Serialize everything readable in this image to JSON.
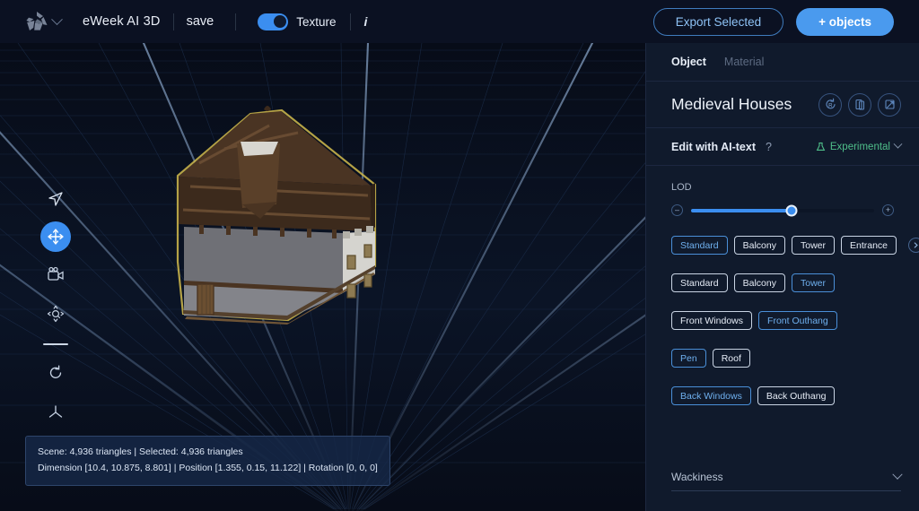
{
  "topbar": {
    "logo_icon": "recycle-logo-icon",
    "logo_chevron_icon": "chevron-down-icon",
    "brand": "eWeek AI 3D",
    "save_label": "save",
    "texture_label": "Texture",
    "texture_on": true,
    "info_label": "i",
    "export_label": "Export Selected",
    "add_objects_label": "+ objects",
    "accent": "#4a9aee"
  },
  "toolbar": {
    "items": [
      {
        "name": "select-cursor-icon",
        "active": false
      },
      {
        "name": "move-tool-icon",
        "active": true
      },
      {
        "name": "camera-tool-icon",
        "active": false
      },
      {
        "name": "scale-tool-icon",
        "active": false
      },
      {
        "name": "divider",
        "active": false
      },
      {
        "name": "rotate-tool-icon",
        "active": false
      },
      {
        "name": "axis-gizmo-icon",
        "active": false
      }
    ]
  },
  "status": {
    "line1": "Scene: 4,936 triangles | Selected: 4,936 triangles",
    "line2": "Dimension [10.4, 10.875, 8.801] | Position [1.355, 0.15, 11.122] | Rotation [0, 0, 0]"
  },
  "panel": {
    "tabs": [
      {
        "label": "Object",
        "active": true
      },
      {
        "label": "Material",
        "active": false
      }
    ],
    "title": "Medieval Houses",
    "title_icons": [
      "reset-rotation-icon",
      "duplicate-icon",
      "transform-icon"
    ],
    "ai_label": "Edit with AI-text",
    "ai_help": "?",
    "experimental_label": "Experimental",
    "experimental_color": "#4fbf8a",
    "experimental_icon": "flask-icon",
    "lod": {
      "label": "LOD",
      "min_icon": "minus-icon",
      "max_icon": "plus-icon",
      "value_pct": 55
    },
    "button_rows": [
      {
        "name": "body-style-row",
        "buttons": [
          {
            "label": "Standard",
            "selected": true
          },
          {
            "label": "Balcony",
            "selected": false
          },
          {
            "label": "Tower",
            "selected": false
          },
          {
            "label": "Entrance",
            "selected": false
          }
        ],
        "overflow_icon": "chevron-right-circle-icon"
      },
      {
        "name": "roof-style-row",
        "buttons": [
          {
            "label": "Standard",
            "selected": false
          },
          {
            "label": "Balcony",
            "selected": false
          },
          {
            "label": "Tower",
            "selected": true
          }
        ],
        "overflow_icon": ""
      },
      {
        "name": "front-detail-row",
        "buttons": [
          {
            "label": "Front Windows",
            "selected": false
          },
          {
            "label": "Front Outhang",
            "selected": true
          }
        ],
        "overflow_icon": ""
      },
      {
        "name": "material-detail-row",
        "buttons": [
          {
            "label": "Pen",
            "selected": true
          },
          {
            "label": "Roof",
            "selected": false
          }
        ],
        "overflow_icon": ""
      },
      {
        "name": "back-detail-row",
        "buttons": [
          {
            "label": "Back Windows",
            "selected": true
          },
          {
            "label": "Back Outhang",
            "selected": false
          }
        ],
        "overflow_icon": ""
      }
    ],
    "wackiness_label": "Wackiness",
    "wackiness_chevron": "chevron-down-icon"
  }
}
